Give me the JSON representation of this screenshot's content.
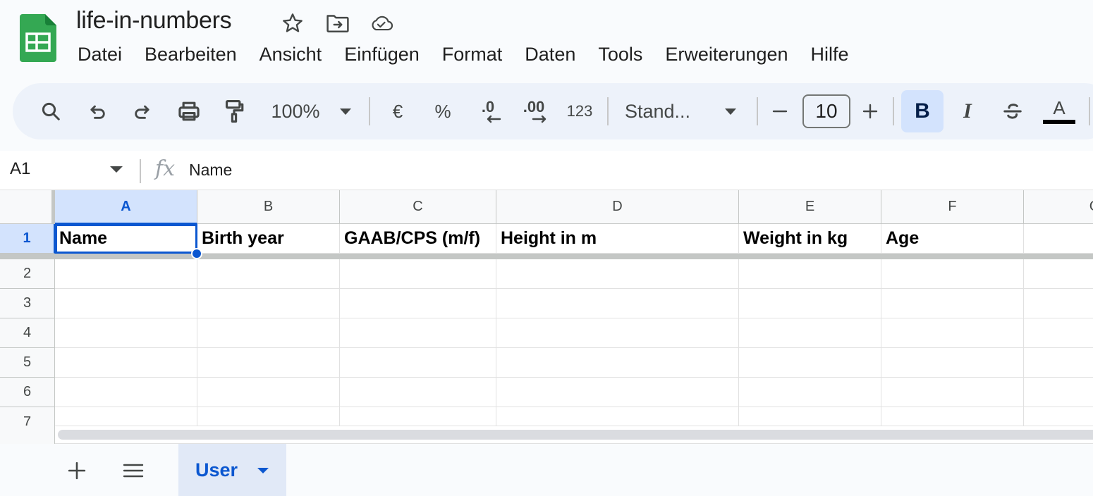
{
  "app": {
    "title": "life-in-numbers",
    "icons": [
      "star-icon",
      "move-to-folder-icon",
      "cloud-saved-icon"
    ]
  },
  "menu": [
    "Datei",
    "Bearbeiten",
    "Ansicht",
    "Einfügen",
    "Format",
    "Daten",
    "Tools",
    "Erweiterungen",
    "Hilfe"
  ],
  "toolbar": {
    "zoom": "100%",
    "currency": "€",
    "percent": "%",
    "decrease_decimal": ".0",
    "increase_decimal": ".00",
    "number_format": "123",
    "font_family": "Stand...",
    "font_size": "10",
    "bold": "B",
    "italic": "I",
    "text_color": "A",
    "text_color_value": "#000000"
  },
  "formula_bar": {
    "cell_ref": "A1",
    "fx": "fx",
    "content": "Name"
  },
  "grid": {
    "columns": [
      "A",
      "B",
      "C",
      "D",
      "E",
      "F",
      "G"
    ],
    "rows": [
      "1",
      "2",
      "3",
      "4",
      "5",
      "6",
      "7"
    ],
    "header_row": [
      "Name",
      "Birth year",
      "GAAB/CPS (m/f)",
      "Height in m",
      "Weight in kg",
      "Age"
    ],
    "selected_cell": "A1"
  },
  "sheets": {
    "active": "User"
  },
  "colors": {
    "accent": "#0b57d0",
    "selection_bg": "#d3e3fd",
    "logo_green": "#34a853"
  }
}
